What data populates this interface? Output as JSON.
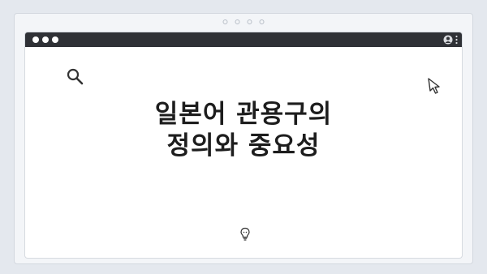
{
  "slide": {
    "title_line1": "일본어 관용구의",
    "title_line2": "정의와 중요성"
  },
  "icons": {
    "search": "search-icon",
    "cursor": "cursor-icon",
    "lightbulb": "lightbulb-icon",
    "user": "user-icon",
    "menu": "kebab-menu-icon"
  },
  "colors": {
    "titlebar": "#2f3136",
    "background": "#e4e8ee",
    "text": "#1d1d1d"
  }
}
